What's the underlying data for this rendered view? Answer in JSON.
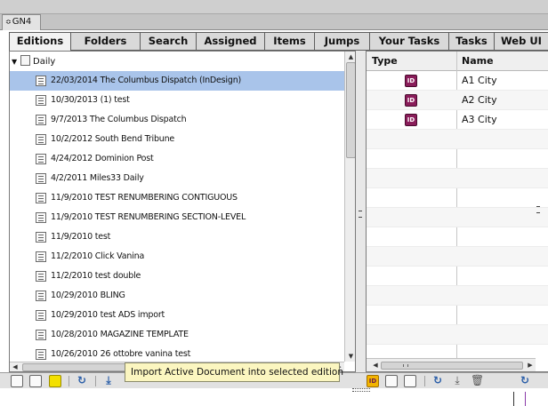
{
  "panel_tab": {
    "label": "GN4",
    "arrow": "≎"
  },
  "tabs": [
    {
      "label": "Editions",
      "active": true
    },
    {
      "label": "Folders",
      "active": false
    },
    {
      "label": "Search",
      "active": false
    },
    {
      "label": "Assigned",
      "active": false
    },
    {
      "label": "Items",
      "active": false
    },
    {
      "label": "Jumps",
      "active": false
    },
    {
      "label": "Your Tasks",
      "active": false
    },
    {
      "label": "Tasks",
      "active": false
    },
    {
      "label": "Web UI",
      "active": false
    }
  ],
  "tree": {
    "root_label": "Daily",
    "expand_glyph": "▼",
    "items": [
      {
        "label": "22/03/2014 The Columbus Dispatch (InDesign)",
        "selected": true
      },
      {
        "label": "10/30/2013 (1) test",
        "selected": false
      },
      {
        "label": "9/7/2013 The Columbus Dispatch",
        "selected": false
      },
      {
        "label": "10/2/2012 South Bend Tribune",
        "selected": false
      },
      {
        "label": "4/24/2012 Dominion Post",
        "selected": false
      },
      {
        "label": "4/2/2011 Miles33 Daily",
        "selected": false
      },
      {
        "label": "11/9/2010 TEST RENUMBERING CONTIGUOUS",
        "selected": false
      },
      {
        "label": "11/9/2010 TEST RENUMBERING SECTION-LEVEL",
        "selected": false
      },
      {
        "label": "11/9/2010 test",
        "selected": false
      },
      {
        "label": "11/2/2010 Click Vanina",
        "selected": false
      },
      {
        "label": "11/2/2010 test double",
        "selected": false
      },
      {
        "label": "10/29/2010 BLING",
        "selected": false
      },
      {
        "label": "10/29/2010 test ADS import",
        "selected": false
      },
      {
        "label": "10/28/2010 MAGAZINE TEMPLATE",
        "selected": false
      },
      {
        "label": "10/26/2010 26 ottobre vanina test",
        "selected": false
      }
    ]
  },
  "pages_table": {
    "headers": {
      "type": "Type",
      "name": "Name"
    },
    "icon_glyph": "ID",
    "rows": [
      {
        "name": "A1 City"
      },
      {
        "name": "A2 City"
      },
      {
        "name": "A3 City"
      }
    ]
  },
  "scroll_glyphs": {
    "up": "▲",
    "down": "▼",
    "left": "◀",
    "right": "▶"
  },
  "toolbar": {
    "refresh_glyph": "↻",
    "import_glyph": "⤓",
    "delete_glyph": "🗑"
  },
  "tooltip": {
    "text": "Import Active Document into selected edition"
  }
}
